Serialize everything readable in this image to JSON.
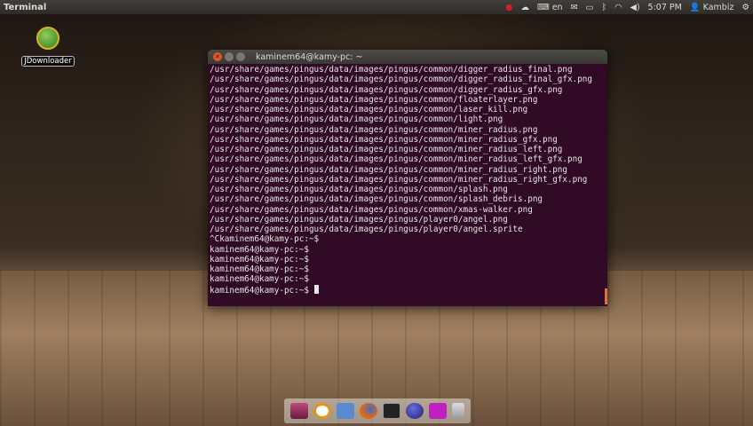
{
  "panel": {
    "app_title": "Terminal",
    "keyboard": "en",
    "time": "5:07 PM",
    "user": "Kambiz"
  },
  "desktop": {
    "icons": [
      {
        "label": "JDownloader"
      }
    ]
  },
  "terminal": {
    "title": "kaminem64@kamy-pc: ~",
    "lines": [
      "/usr/share/games/pingus/data/images/pingus/common/digger_radius_final.png",
      "/usr/share/games/pingus/data/images/pingus/common/digger_radius_final_gfx.png",
      "/usr/share/games/pingus/data/images/pingus/common/digger_radius_gfx.png",
      "/usr/share/games/pingus/data/images/pingus/common/floaterlayer.png",
      "/usr/share/games/pingus/data/images/pingus/common/laser_kill.png",
      "/usr/share/games/pingus/data/images/pingus/common/light.png",
      "/usr/share/games/pingus/data/images/pingus/common/miner_radius.png",
      "/usr/share/games/pingus/data/images/pingus/common/miner_radius_gfx.png",
      "/usr/share/games/pingus/data/images/pingus/common/miner_radius_left.png",
      "/usr/share/games/pingus/data/images/pingus/common/miner_radius_left_gfx.png",
      "/usr/share/games/pingus/data/images/pingus/common/miner_radius_right.png",
      "/usr/share/games/pingus/data/images/pingus/common/miner_radius_right_gfx.png",
      "/usr/share/games/pingus/data/images/pingus/common/splash.png",
      "/usr/share/games/pingus/data/images/pingus/common/splash_debris.png",
      "/usr/share/games/pingus/data/images/pingus/common/xmas-walker.png",
      "/usr/share/games/pingus/data/images/pingus/player0/angel.png",
      "/usr/share/games/pingus/data/images/pingus/player0/angel.sprite",
      "^Ckaminem64@kamy-pc:~$",
      "kaminem64@kamy-pc:~$",
      "kaminem64@kamy-pc:~$",
      "kaminem64@kamy-pc:~$",
      "kaminem64@kamy-pc:~$",
      "kaminem64@kamy-pc:~$"
    ]
  },
  "dock": {
    "items": [
      "Workspaces",
      "Clock",
      "Files",
      "Firefox",
      "Terminal",
      "Eclipse",
      "Paint",
      "Trash"
    ]
  }
}
